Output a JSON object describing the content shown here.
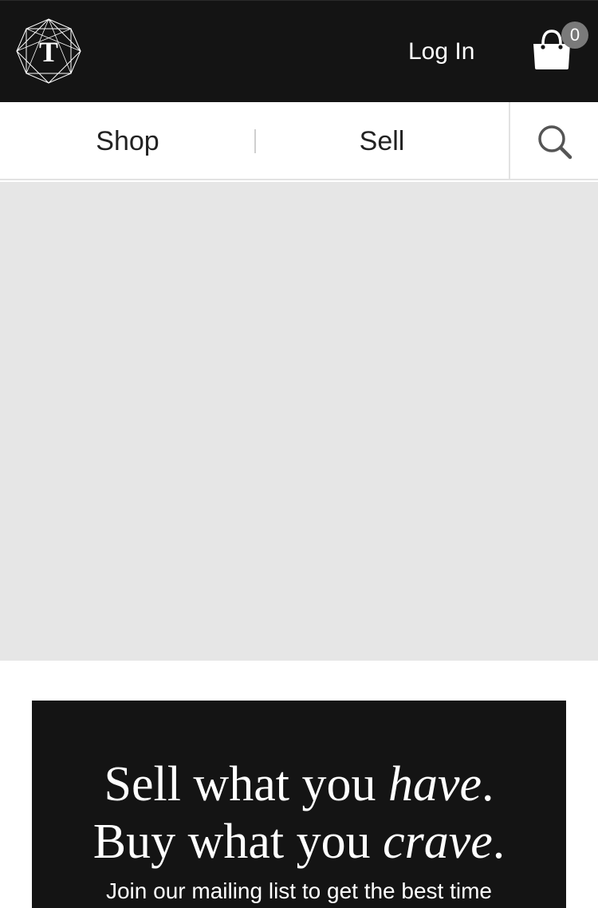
{
  "header": {
    "logo_letter": "T",
    "login_label": "Log In",
    "cart_count": "0"
  },
  "nav": {
    "shop_label": "Shop",
    "sell_label": "Sell"
  },
  "promo": {
    "line1_prefix": "Sell what you ",
    "line1_emphasis": "have",
    "line1_suffix": ".",
    "line2_prefix": "Buy what you ",
    "line2_emphasis": "crave",
    "line2_suffix": ".",
    "subtext": "Join our mailing list to get the best time"
  },
  "icons": {
    "logo": "geometric-t-logo-icon",
    "cart": "shopping-bag-icon",
    "search": "search-icon"
  },
  "colors": {
    "header_bg": "#141414",
    "hero_placeholder": "#e6e6e6",
    "badge": "#7a7a7a"
  }
}
